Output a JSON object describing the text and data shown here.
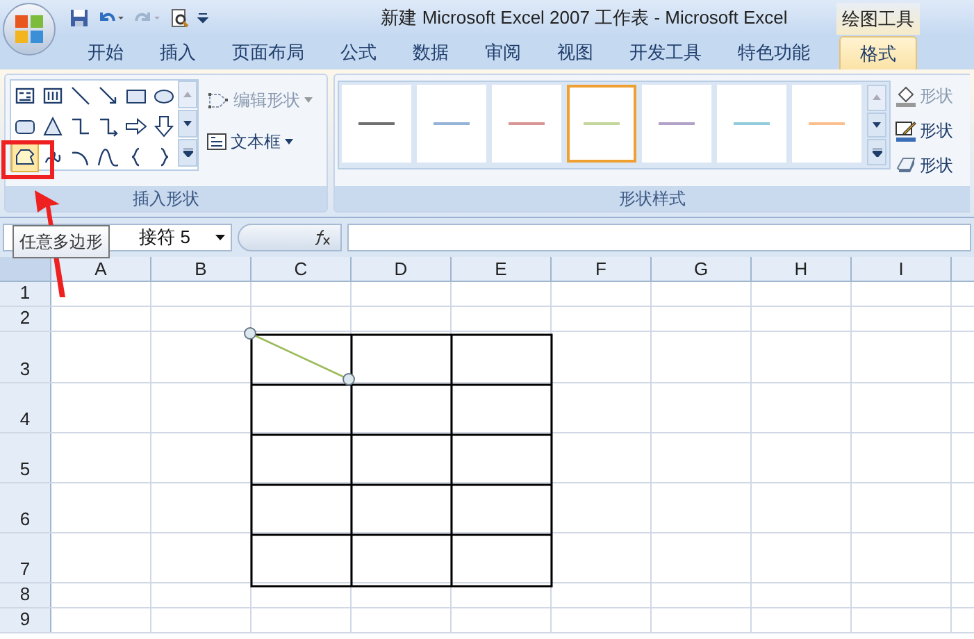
{
  "title": "新建 Microsoft Excel 2007 工作表 - Microsoft Excel",
  "context_tab": "绘图工具",
  "tabs": [
    {
      "label": "开始",
      "selected": false
    },
    {
      "label": "插入",
      "selected": false
    },
    {
      "label": "页面布局",
      "selected": false
    },
    {
      "label": "公式",
      "selected": false
    },
    {
      "label": "数据",
      "selected": false
    },
    {
      "label": "审阅",
      "selected": false
    },
    {
      "label": "视图",
      "selected": false
    },
    {
      "label": "开发工具",
      "selected": false
    },
    {
      "label": "特色功能",
      "selected": false
    },
    {
      "label": "格式",
      "selected": true
    }
  ],
  "insert_shapes": {
    "label": "插入形状",
    "edit_shape": "编辑形状",
    "textbox": "文本框",
    "shapes": [
      {
        "kind": "textbox",
        "selected": false
      },
      {
        "kind": "vtextbox",
        "selected": false
      },
      {
        "kind": "line",
        "selected": false
      },
      {
        "kind": "arrow",
        "selected": false
      },
      {
        "kind": "rect",
        "selected": false
      },
      {
        "kind": "oval",
        "selected": false
      },
      {
        "kind": "roundrect",
        "selected": false
      },
      {
        "kind": "triangle",
        "selected": false
      },
      {
        "kind": "elbow",
        "selected": false
      },
      {
        "kind": "elbowarrow",
        "selected": false
      },
      {
        "kind": "rightarrow",
        "selected": false
      },
      {
        "kind": "downarrow",
        "selected": false
      },
      {
        "kind": "freeform",
        "selected": true
      },
      {
        "kind": "scribble",
        "selected": false
      },
      {
        "kind": "arc",
        "selected": false
      },
      {
        "kind": "curve",
        "selected": false
      },
      {
        "kind": "lbrace",
        "selected": false
      },
      {
        "kind": "rbrace",
        "selected": false
      }
    ]
  },
  "shape_styles": {
    "label": "形状样式",
    "styles": [
      {
        "color": "#707070",
        "selected": false
      },
      {
        "color": "#95b3d7",
        "selected": false
      },
      {
        "color": "#d99694",
        "selected": false
      },
      {
        "color": "#c3d69b",
        "selected": true
      },
      {
        "color": "#b3a2c7",
        "selected": false
      },
      {
        "color": "#93cddd",
        "selected": false
      },
      {
        "color": "#fac090",
        "selected": false
      }
    ],
    "commands": [
      {
        "kind": "fill",
        "label": "形状"
      },
      {
        "kind": "outline",
        "label": "形状"
      },
      {
        "kind": "effect",
        "label": "形状"
      }
    ]
  },
  "name_box": "接符 5",
  "tooltip": "任意多边形",
  "columns": [
    "A",
    "B",
    "C",
    "D",
    "E",
    "F",
    "G",
    "H",
    "I"
  ],
  "rows": [
    "1",
    "2",
    "3",
    "4",
    "5",
    "6",
    "7",
    "8",
    "9"
  ]
}
